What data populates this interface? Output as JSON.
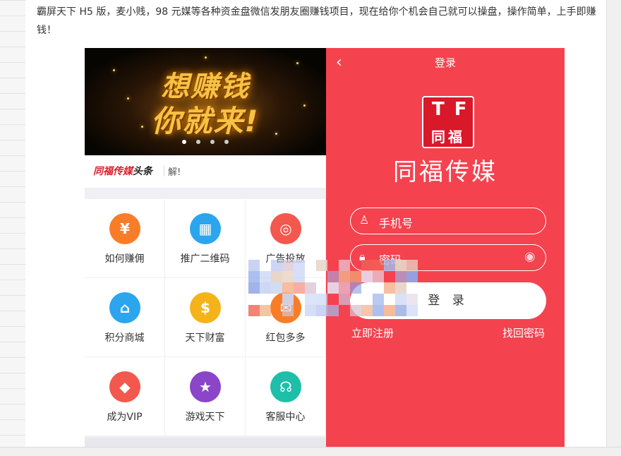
{
  "article": {
    "intro": "霸屏天下 H5 版，麦小贱，98 元媒等各种资金盘微信发朋友圈赚钱项目，现在给你个机会自己就可以操盘，操作简单，上手即赚钱！"
  },
  "banner": {
    "line1": "想赚钱",
    "line2": "你就来!",
    "dots": 4,
    "active_dot": 0
  },
  "news": {
    "logo_red": "同福传媒",
    "logo_black": "头条",
    "text": "解!"
  },
  "menu": [
    {
      "label": "如何赚佣",
      "icon": "yen-hand-icon",
      "glyph": "¥",
      "color": "#f97d28"
    },
    {
      "label": "推广二维码",
      "icon": "qrcode-icon",
      "glyph": "▦",
      "color": "#2ba6ee"
    },
    {
      "label": "广告投放",
      "icon": "target-icon",
      "glyph": "◎",
      "color": "#f2584d"
    },
    {
      "label": "积分商城",
      "icon": "store-icon",
      "glyph": "⌂",
      "color": "#2ba6ee"
    },
    {
      "label": "天下财富",
      "icon": "coins-icon",
      "glyph": "$",
      "color": "#f5b31b"
    },
    {
      "label": "红包多多",
      "icon": "red-envelope-icon",
      "glyph": "✉",
      "color": "#f97d28"
    },
    {
      "label": "成为VIP",
      "icon": "diamond-icon",
      "glyph": "◆",
      "color": "#f2584d"
    },
    {
      "label": "游戏天下",
      "icon": "star-icon",
      "glyph": "★",
      "color": "#8b45c9"
    },
    {
      "label": "客服中心",
      "icon": "headset-icon",
      "glyph": "☊",
      "color": "#1ebfa8"
    }
  ],
  "login": {
    "back_icon": "chevron-left-icon",
    "title": "登录",
    "logo_letters": "TF",
    "logo_chars": "同福",
    "brand": "同福传媒",
    "phone_placeholder": "手机号",
    "password_placeholder": "密码",
    "submit": "登 录",
    "register": "立即注册",
    "forgot": "找回密码",
    "accent": "#f5424f"
  }
}
